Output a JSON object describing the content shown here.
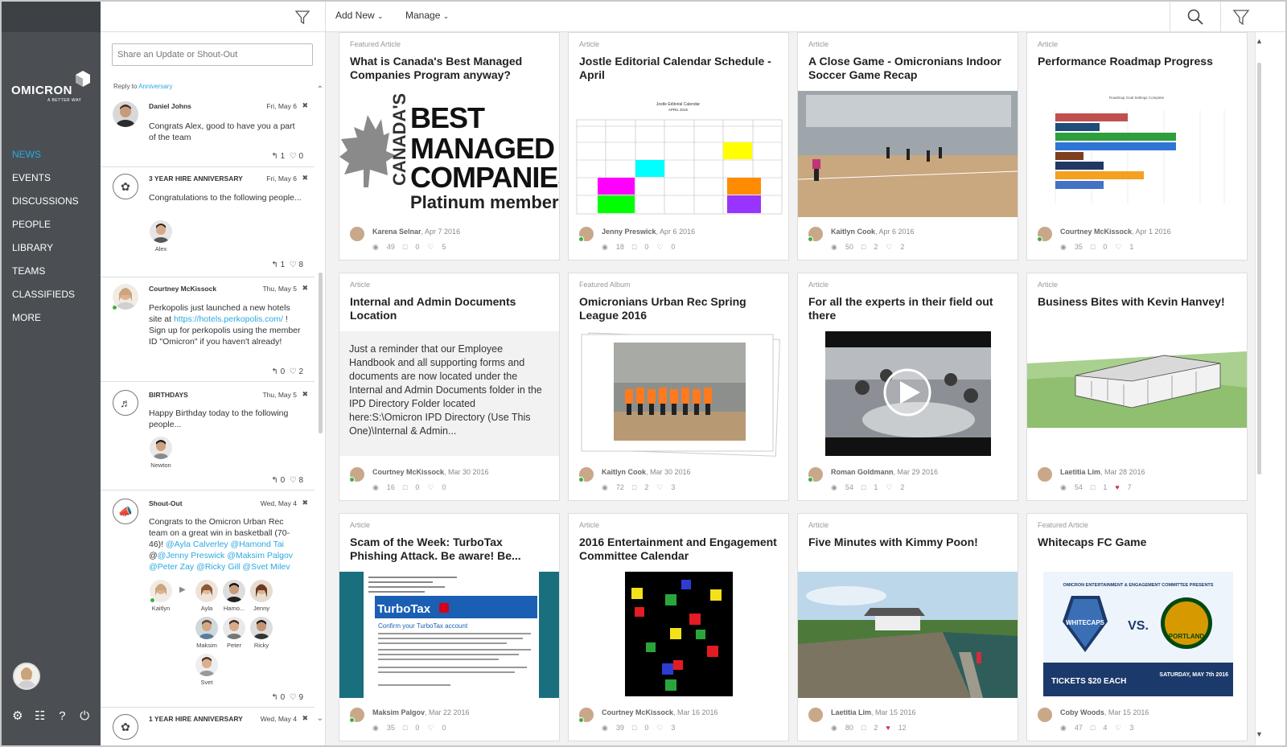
{
  "nav": {
    "logo": {
      "word": "OMICRON",
      "tagline": "A BETTER WAY"
    },
    "items": [
      "NEWS",
      "EVENTS",
      "DISCUSSIONS",
      "PEOPLE",
      "LIBRARY",
      "TEAMS",
      "CLASSIFIEDS",
      "MORE"
    ],
    "active": "NEWS",
    "bottom_icons": [
      "gear-icon",
      "sliders-icon",
      "help-icon",
      "power-icon"
    ]
  },
  "header": {
    "add_new": "Add New",
    "manage": "Manage"
  },
  "feed": {
    "share_placeholder": "Share an Update or Shout-Out",
    "reply_to_label": "Reply to",
    "reply_to_link": "Anniversary",
    "posts": [
      {
        "author": "Daniel Johns",
        "date": "Fri, May 6",
        "text": "Congrats Alex, good to have you a part of the team",
        "replies": "1",
        "likes": "0"
      },
      {
        "author": "3 YEAR HIRE ANNIVERSARY",
        "date": "Fri, May 6",
        "text": "Congratulations to the following people...",
        "people": [
          "Alex"
        ],
        "replies": "1",
        "likes": "8"
      },
      {
        "author": "Courtney McKissock",
        "date": "Thu, May 5",
        "text_pre": "Perkopolis just launched a new hotels site at ",
        "link": "https://hotels.perkopolis.com/",
        "text_post": " ! Sign up for perkopolis using the member ID \"Omicron\" if you haven't already!",
        "replies": "0",
        "likes": "2"
      },
      {
        "author": "BIRTHDAYS",
        "date": "Thu, May 5",
        "text": "Happy Birthday today to the following people...",
        "people": [
          "Newton"
        ],
        "replies": "0",
        "likes": "8"
      },
      {
        "author": "Shout-Out",
        "date": "Wed, May 4",
        "text_pre": "Congrats to the Omicron Urban Rec team on a great win in basketball (70-46)! ",
        "mentions_1": "@Ayla Calverley @Hamond Tai",
        "at": "@",
        "mentions_2": "@Jenny Preswick @Maksim Palgov",
        "mentions_3": "@Peter Zay @Ricky Gill @Svet Milev",
        "sender": "Kaitlyn",
        "people": [
          "Ayla",
          "Hamo...",
          "Jenny",
          "Maksim",
          "Peter",
          "Ricky",
          "Svet"
        ],
        "replies": "0",
        "likes": "9"
      },
      {
        "author": "1 YEAR HIRE ANNIVERSARY",
        "date": "Wed, May 4"
      }
    ]
  },
  "cards": [
    {
      "type": "Featured Article",
      "title": "What is Canada's Best Managed Companies Program anyway?",
      "author": "Karena Selnar",
      "date": ", Apr 7 2016",
      "views": "49",
      "comments": "0",
      "likes": "5",
      "media": {
        "vertical": "CANADA'S",
        "l1": "BEST",
        "l2": "MANAGED",
        "l3": "COMPANIES",
        "l4": "Platinum member"
      }
    },
    {
      "type": "Article",
      "title": "Jostle Editorial Calendar Schedule - April",
      "author": "Jenny Preswick",
      "date": ", Apr 6 2016",
      "views": "18",
      "comments": "0",
      "likes": "0",
      "media": {
        "cal_title": "Jostle Editorial Calendar",
        "cal_month": "APRIL 2016"
      }
    },
    {
      "type": "Article",
      "title": "A Close Game - Omicronians Indoor Soccer Game Recap",
      "author": "Kaitlyn Cook",
      "date": ", Apr 6 2016",
      "views": "50",
      "comments": "2",
      "likes": "2"
    },
    {
      "type": "Article",
      "title": "Performance Roadmap Progress",
      "author": "Courtney McKissock",
      "date": ", Apr 1 2016",
      "views": "35",
      "comments": "0",
      "likes": "1",
      "media": {
        "chart_title": "Roadmap Goal Settings Complete"
      }
    },
    {
      "type": "Article",
      "title": "Internal and Admin Documents Location",
      "author": "Courtney McKissock",
      "date": ", Mar 30 2016",
      "views": "16",
      "comments": "0",
      "likes": "0",
      "excerpt": "Just a reminder that our Employee Handbook and all supporting forms and documents are now located under the Internal and Admin Documents folder in the IPD Directory Folder located here:S:\\Omicron IPD Directory (Use This One)\\Internal & Admin..."
    },
    {
      "type": "Featured Album",
      "title": "Omicronians Urban Rec Spring League 2016",
      "author": "Kaitlyn Cook",
      "date": ", Mar 30 2016",
      "views": "72",
      "comments": "2",
      "likes": "3"
    },
    {
      "type": "Article",
      "title": "For all the experts in their field out there",
      "author": "Roman Goldmann",
      "date": ", Mar 29 2016",
      "views": "54",
      "comments": "1",
      "likes": "2"
    },
    {
      "type": "Article",
      "title": "Business Bites with Kevin Hanvey!",
      "author": "Laetitia Lim",
      "date": ", Mar 28 2016",
      "views": "54",
      "comments": "1",
      "likes": "7",
      "liked": true
    },
    {
      "type": "Article",
      "title": "Scam of the Week: TurboTax Phishing Attack. Be aware! Be...",
      "author": "Maksim Palgov",
      "date": ", Mar 22 2016",
      "views": "35",
      "comments": "0",
      "likes": "0",
      "media": {
        "brand": "TurboTax",
        "heading": "Confirm your TurboTax account"
      }
    },
    {
      "type": "Article",
      "title": "2016 Entertainment and Engagement Committee Calendar",
      "author": "Courtney McKissock",
      "date": ", Mar 16 2016",
      "views": "39",
      "comments": "0",
      "likes": "3"
    },
    {
      "type": "Article",
      "title": "Five Minutes with Kimmy Poon!",
      "author": "Laetitia Lim",
      "date": ", Mar 15 2016",
      "views": "80",
      "comments": "2",
      "likes": "12",
      "liked": true
    },
    {
      "type": "Featured Article",
      "title": "Whitecaps FC Game",
      "author": "Coby Woods",
      "date": ", Mar 15 2016",
      "views": "47",
      "comments": "4",
      "likes": "3",
      "media": {
        "presents": "OMICRON ENTERTAINMENT & ENGAGEMENT COMMITTEE PRESENTS",
        "team1": "WHITECAPS",
        "vs": "VS.",
        "team2": "PORTLAND",
        "tickets": "TICKETS $20 EACH",
        "when": "SATURDAY, MAY 7th 2016"
      }
    }
  ],
  "colors": {
    "nav_bg": "#4b4f54",
    "accent": "#29a8e0",
    "online": "#3cb043",
    "liked": "#d9304b"
  }
}
